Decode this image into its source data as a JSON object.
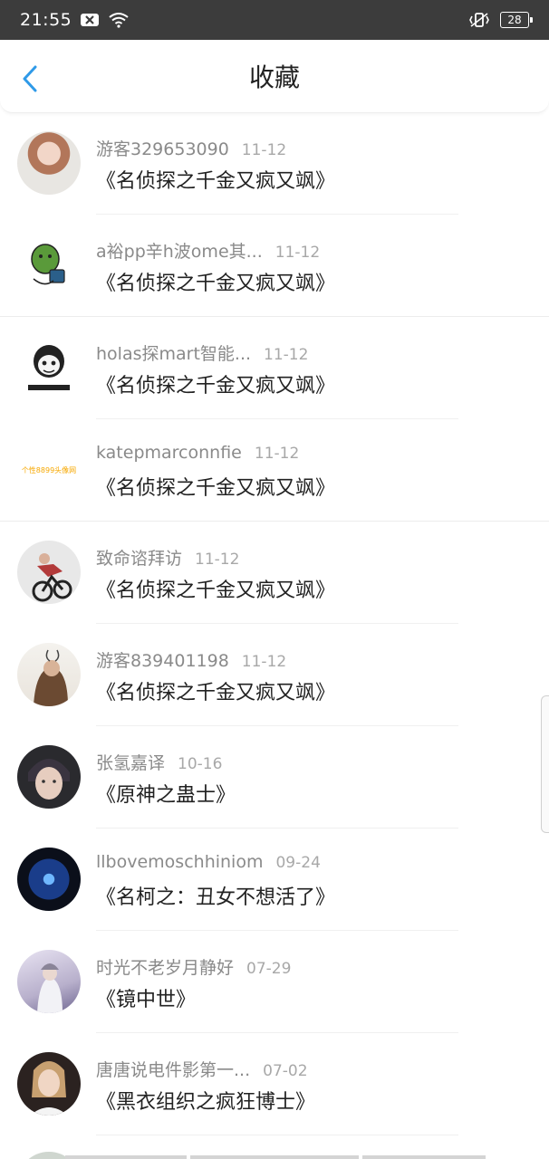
{
  "status_bar": {
    "time": "21:55",
    "battery": "28"
  },
  "nav": {
    "title": "收藏"
  },
  "items": [
    {
      "username": "游客329653090",
      "date": "11-12",
      "title": "《名侦探之千金又疯又飒》",
      "avatar_color": "#c9a58c"
    },
    {
      "username": "a裕pp辛h波ome其...",
      "date": "11-12",
      "title": "《名侦探之千金又疯又飒》",
      "avatar_color": "#5a9a3a"
    },
    {
      "username": "holas探mart智能...",
      "date": "11-12",
      "title": "《名侦探之千金又疯又飒》",
      "avatar_color": "#222222"
    },
    {
      "username": "katepmarconnfie",
      "date": "11-12",
      "title": "《名侦探之千金又疯又飒》",
      "avatar_color": "#f7a800",
      "avatar_text": "个性8899头像网"
    },
    {
      "username": "致命谘拜访",
      "date": "11-12",
      "title": "《名侦探之千金又疯又飒》",
      "avatar_color": "#b23a3a"
    },
    {
      "username": "游客839401198",
      "date": "11-12",
      "title": "《名侦探之千金又疯又飒》",
      "avatar_color": "#7a5a40"
    },
    {
      "username": "张氢嘉译",
      "date": "10-16",
      "title": "《原神之蛊士》",
      "avatar_color": "#6a6a78"
    },
    {
      "username": "llbovemoschhiniom",
      "date": "09-24",
      "title": "《名柯之：丑女不想活了》",
      "avatar_color": "#1a3d8a"
    },
    {
      "username": "时光不老岁月静好",
      "date": "07-29",
      "title": "《镜中世》",
      "avatar_color": "#b8b0cc"
    },
    {
      "username": "唐唐说电件影第一...",
      "date": "07-02",
      "title": "《黑衣组织之疯狂博士》",
      "avatar_color": "#c8a88a"
    }
  ]
}
